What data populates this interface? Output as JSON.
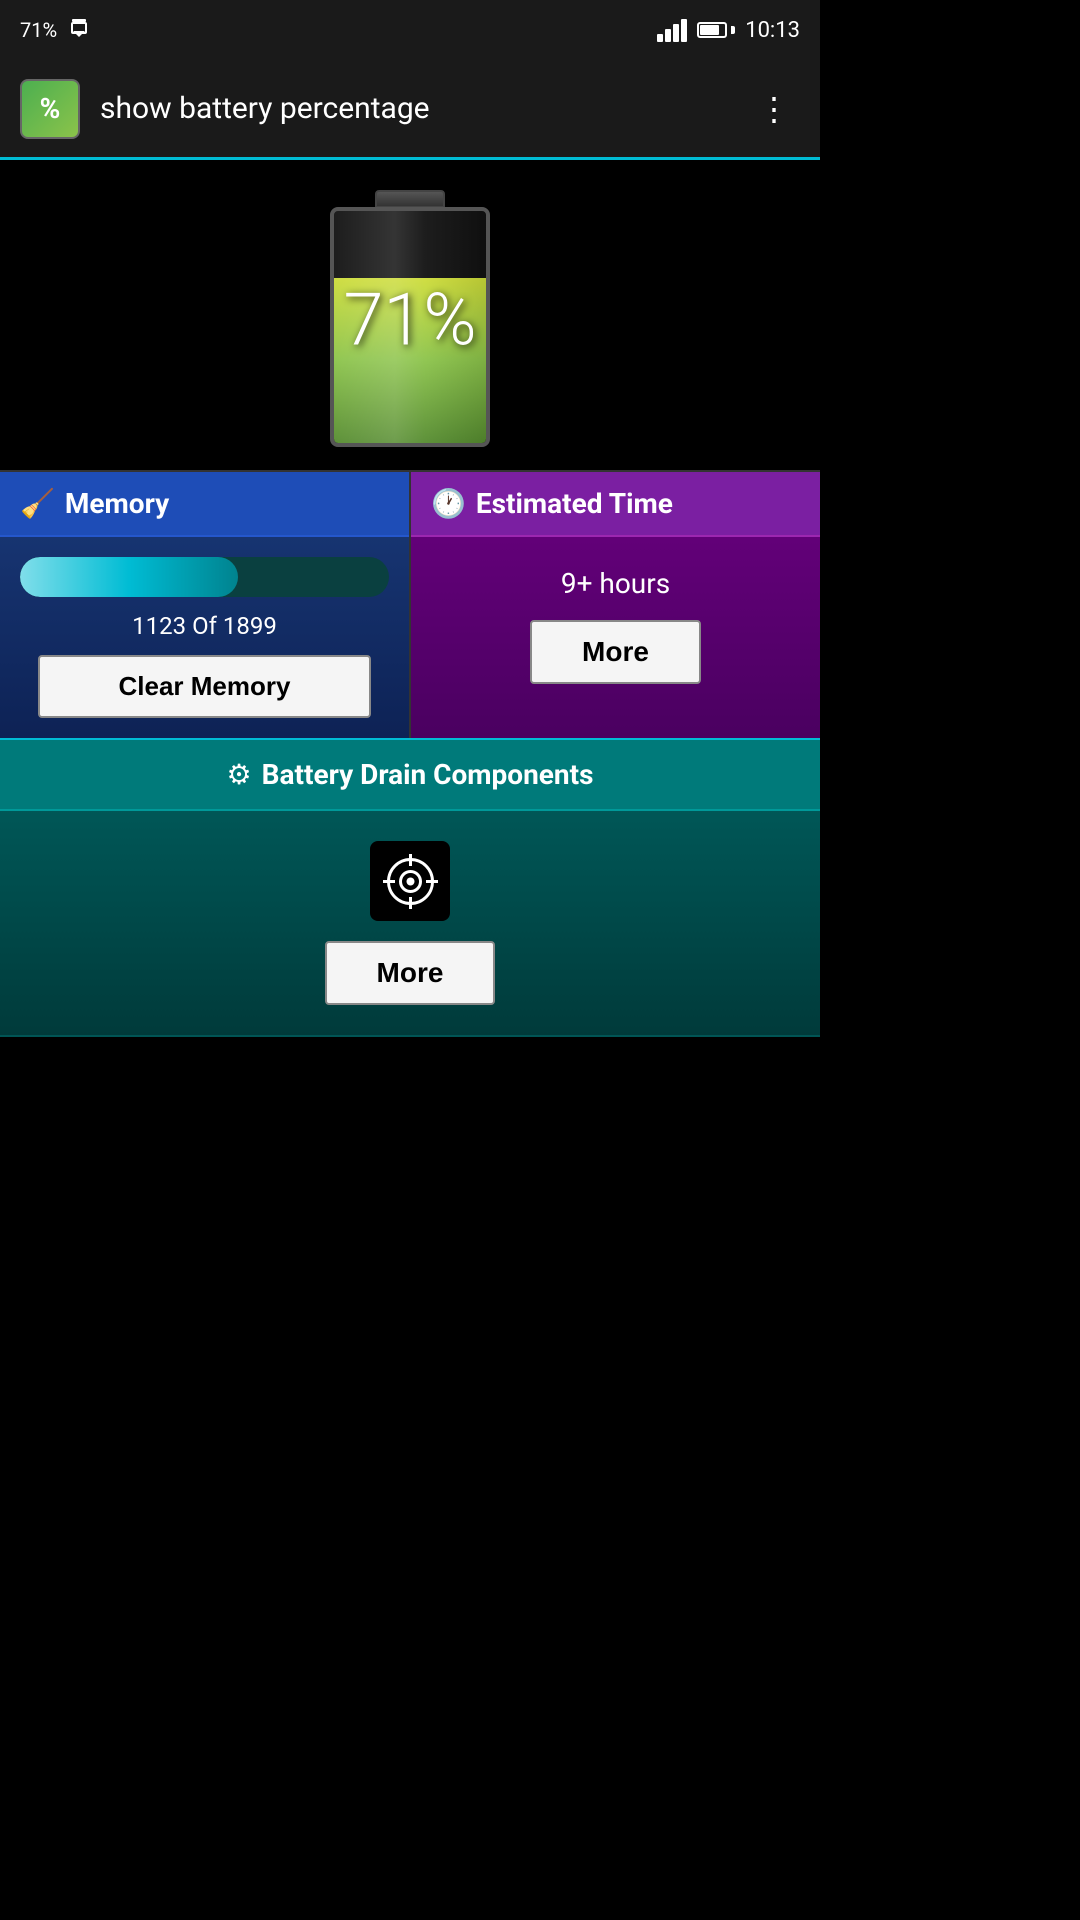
{
  "statusBar": {
    "batteryPercent": "71%",
    "time": "10:13",
    "signalBars": 4,
    "downloadIndicator": "⬇"
  },
  "appBar": {
    "title": "show battery percentage",
    "iconLabel": "%",
    "moreMenuLabel": "⋮"
  },
  "batteryDisplay": {
    "percentage": "71%",
    "fillPercent": 71
  },
  "memoryPanel": {
    "headerLabel": "Memory",
    "progressFilled": 1123,
    "progressTotal": 1899,
    "statsLabel": "1123 Of 1899",
    "clearButtonLabel": "Clear Memory",
    "progressPercent": 59.1
  },
  "timePanel": {
    "headerLabel": "Estimated Time",
    "timeValue": "9+ hours",
    "moreButtonLabel": "More"
  },
  "drainSection": {
    "headerLabel": "Battery Drain Components",
    "moreButtonLabel": "More"
  }
}
